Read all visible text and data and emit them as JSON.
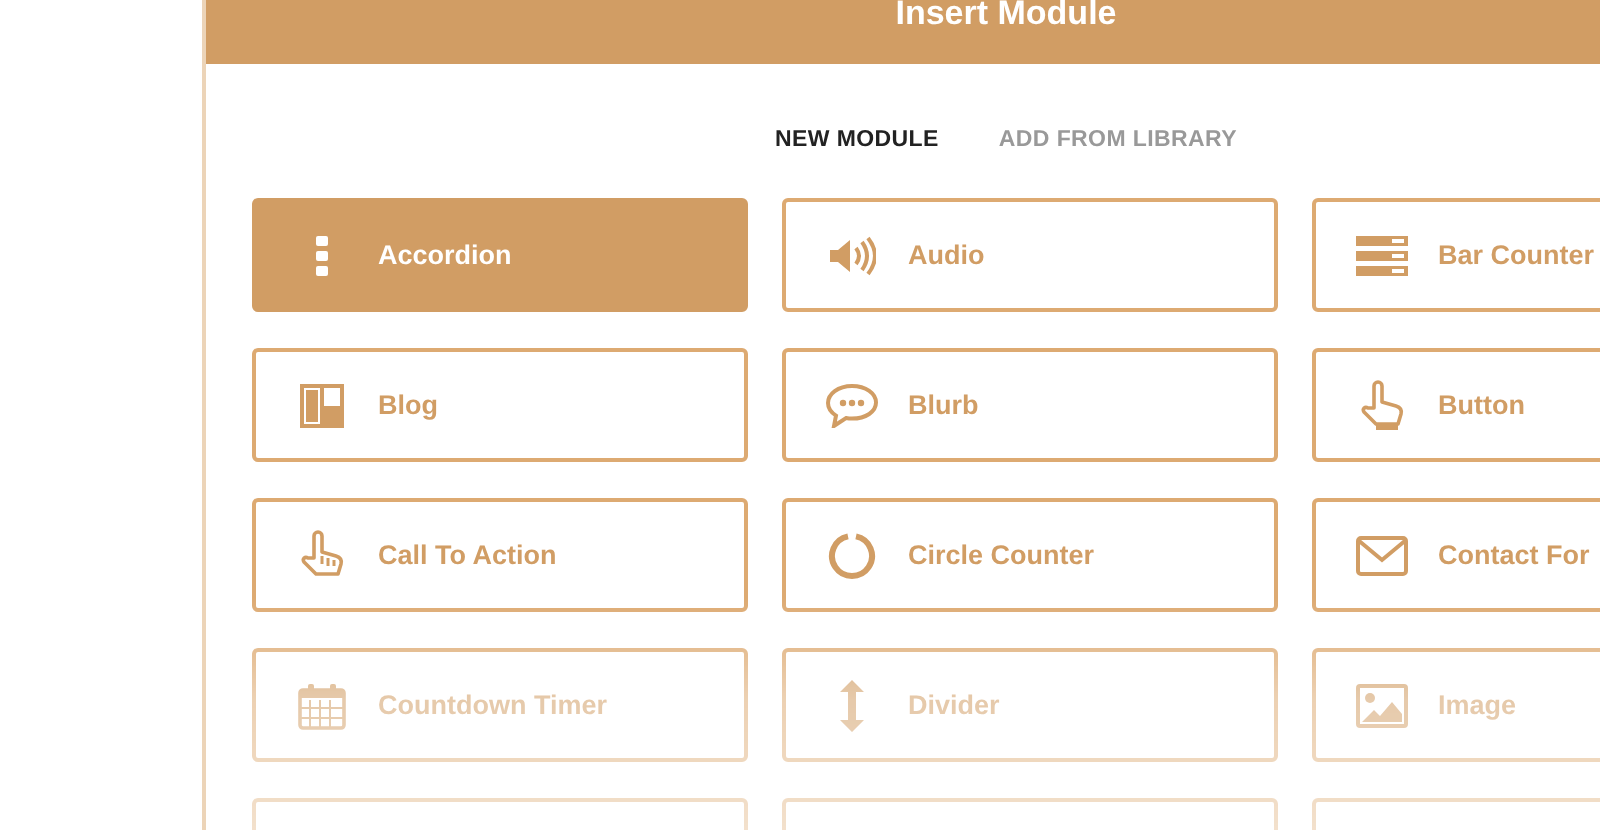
{
  "modal": {
    "title": "Insert Module"
  },
  "tabs": [
    {
      "label": "NEW MODULE",
      "selected": true
    },
    {
      "label": "ADD FROM LIBRARY",
      "selected": false
    }
  ],
  "modules": [
    {
      "kind": "accordion",
      "label": "Accordion",
      "selected": true
    },
    {
      "kind": "audio",
      "label": "Audio",
      "selected": false
    },
    {
      "kind": "bars",
      "label": "Bar Counter",
      "selected": false
    },
    {
      "kind": "blog",
      "label": "Blog",
      "selected": false
    },
    {
      "kind": "blurb",
      "label": "Blurb",
      "selected": false
    },
    {
      "kind": "button",
      "label": "Button",
      "selected": false
    },
    {
      "kind": "cta",
      "label": "Call To Action",
      "selected": false
    },
    {
      "kind": "circle",
      "label": "Circle Counter",
      "selected": false
    },
    {
      "kind": "contact",
      "label": "Contact For",
      "selected": false
    },
    {
      "kind": "countdown",
      "label": "Countdown Timer",
      "selected": false
    },
    {
      "kind": "divider",
      "label": "Divider",
      "selected": false
    },
    {
      "kind": "image",
      "label": "Image",
      "selected": false
    },
    {
      "kind": "cut",
      "selected": false
    },
    {
      "kind": "cut",
      "selected": false
    },
    {
      "kind": "cut",
      "selected": false
    }
  ]
}
